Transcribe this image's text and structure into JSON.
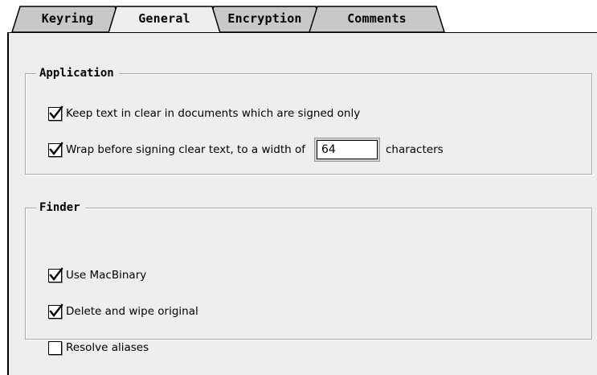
{
  "tabs": [
    {
      "label": "Keyring",
      "selected": false
    },
    {
      "label": "General",
      "selected": true
    },
    {
      "label": "Encryption",
      "selected": false
    },
    {
      "label": "Comments",
      "selected": false
    }
  ],
  "application": {
    "title": "Application",
    "keep_text": {
      "label": "Keep text in clear in documents which are signed only",
      "checked": true
    },
    "wrap": {
      "label": "Wrap before signing clear text, to a width of",
      "checked": true,
      "width_value": "64",
      "suffix": "characters"
    }
  },
  "finder": {
    "title": "Finder",
    "use_macbinary": {
      "label": "Use MacBinary",
      "checked": true
    },
    "delete_wipe": {
      "label": "Delete and wipe original",
      "checked": true
    },
    "resolve_aliases": {
      "label": "Resolve aliases",
      "checked": false
    }
  },
  "colors": {
    "panel_background": "#eeeeee",
    "inactive_tab": "#c8c8c8",
    "group_border": "#a9a9a9"
  },
  "icons": {
    "checkmark": "checkmark-icon"
  }
}
